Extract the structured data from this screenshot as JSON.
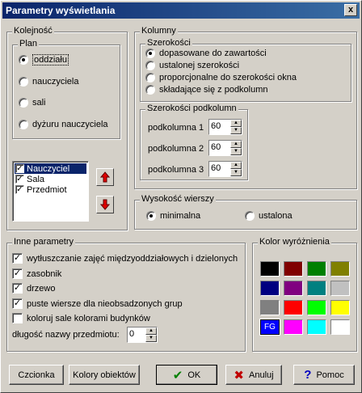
{
  "window": {
    "title": "Parametry wyświetlania",
    "close_label": "x"
  },
  "kolejnosc": {
    "label": "Kolejność",
    "plan": {
      "label": "Plan",
      "options": [
        "oddziału",
        "nauczyciela",
        "sali",
        "dyżuru nauczyciela"
      ],
      "selected": 0
    },
    "list": [
      {
        "label": "Nauczyciel",
        "checked": true,
        "selected": true
      },
      {
        "label": "Sala",
        "checked": true,
        "selected": false
      },
      {
        "label": "Przedmiot",
        "checked": true,
        "selected": false
      }
    ],
    "up_icon": "arrow-up-icon",
    "down_icon": "arrow-down-icon"
  },
  "kolumny": {
    "label": "Kolumny",
    "szerokosci": {
      "label": "Szerokości",
      "options": [
        "dopasowane do zawartości",
        "ustalonej szerokości",
        "proporcjonalne do szerokości okna",
        "składające się z podkolumn"
      ],
      "selected": 0
    },
    "podkolumny": {
      "label": "Szerokości podkolumn",
      "items": [
        {
          "label": "podkolumna 1",
          "value": "60"
        },
        {
          "label": "podkolumna 2",
          "value": "60"
        },
        {
          "label": "podkolumna 3",
          "value": "60"
        }
      ]
    }
  },
  "wysokosc": {
    "label": "Wysokość wierszy",
    "options": [
      "minimalna",
      "ustalona"
    ],
    "selected": 0
  },
  "inne": {
    "label": "Inne parametry",
    "checks": [
      {
        "label": "wytłuszczanie zajęć międzyoddziałowych i dzielonych",
        "checked": true
      },
      {
        "label": "zasobnik",
        "checked": true
      },
      {
        "label": "drzewo",
        "checked": true
      },
      {
        "label": "puste wiersze dla nieobsadzonych grup",
        "checked": true
      },
      {
        "label": "koloruj sale kolorami budynków",
        "checked": false
      }
    ],
    "length_label": "długość nazwy przedmiotu:",
    "length_value": "0"
  },
  "kolor": {
    "label": "Kolor wyróżnienia",
    "swatches": [
      "#000000",
      "#800000",
      "#008000",
      "#808000",
      "#000080",
      "#800080",
      "#008080",
      "#c0c0c0",
      "#808080",
      "#ff0000",
      "#00ff00",
      "#ffff00",
      "#0000ff",
      "#ff00ff",
      "#00ffff",
      "#ffffff"
    ],
    "fg_label": "FG"
  },
  "buttons": {
    "czcionka": "Czcionka",
    "kolory": "Kolory obiektów",
    "ok": "OK",
    "anuluj": "Anuluj",
    "pomoc": "Pomoc"
  },
  "check_mark": "✓"
}
